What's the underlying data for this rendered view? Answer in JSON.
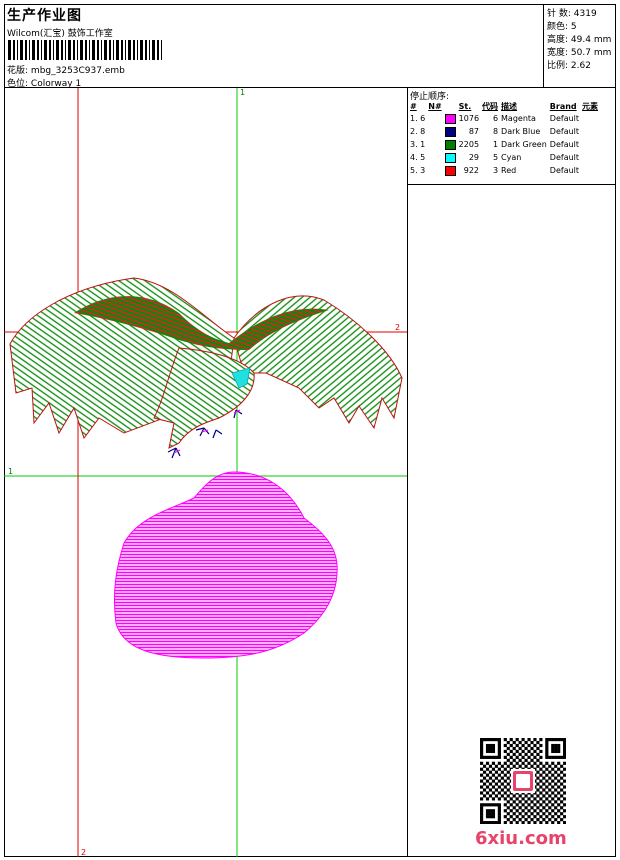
{
  "header": {
    "title": "生产作业图",
    "company": "Wilcom(汇宝) 鼓饰工作室",
    "design_label": "花版:",
    "design_file": "mbg_3253C937.emb",
    "colorway_label": "色位:",
    "colorway": "Colorway 1"
  },
  "stats": [
    {
      "label": "针 数:",
      "value": "4319"
    },
    {
      "label": "颜色:",
      "value": "5"
    },
    {
      "label": "高度:",
      "value": "49.4 mm"
    },
    {
      "label": "宽度:",
      "value": "50.7 mm"
    },
    {
      "label": "比例:",
      "value": "2.62"
    }
  ],
  "sequence": {
    "title": "停止顺序:",
    "headers": [
      "#",
      "N#",
      "St.",
      "代码",
      "描述",
      "Brand",
      "元素"
    ],
    "rows": [
      {
        "stop": "1. 6",
        "stitches": "1076",
        "code": "6",
        "desc": "Magenta",
        "brand": "Default",
        "color": "#ff00ff"
      },
      {
        "stop": "2. 8",
        "stitches": "87",
        "code": "8",
        "desc": "Dark Blue",
        "brand": "Default",
        "color": "#000080"
      },
      {
        "stop": "3. 1",
        "stitches": "2205",
        "code": "1",
        "desc": "Dark Green",
        "brand": "Default",
        "color": "#008000"
      },
      {
        "stop": "4. 5",
        "stitches": "29",
        "code": "5",
        "desc": "Cyan",
        "brand": "Default",
        "color": "#00ffff"
      },
      {
        "stop": "5. 3",
        "stitches": "922",
        "code": "3",
        "desc": "Red",
        "brand": "Default",
        "color": "#ff0000"
      }
    ]
  },
  "guides": {
    "g1_top": "1",
    "g1_left": "1",
    "g2_right": "2",
    "g2_bottom": "2"
  },
  "watermark": "6xiu.com"
}
